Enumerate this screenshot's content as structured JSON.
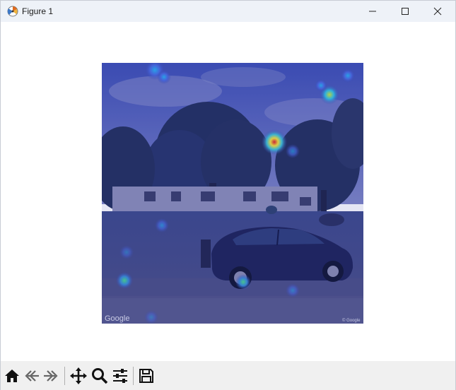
{
  "window": {
    "title": "Figure 1",
    "controls": [
      "minimize",
      "maximize",
      "close"
    ]
  },
  "figure": {
    "image_description_icons": "heatmap-overlay-image",
    "watermark_left": "Google",
    "watermark_right": "© Google"
  },
  "toolbar": {
    "buttons": [
      "home-icon",
      "back-icon",
      "forward-icon",
      "pan-icon",
      "zoom-icon",
      "configure-subplots-icon",
      "save-icon"
    ]
  },
  "colors": {
    "titlebar_bg": "#eef2f8",
    "toolbar_bg": "#f0f0f0",
    "overlay": "#2b35a8"
  }
}
